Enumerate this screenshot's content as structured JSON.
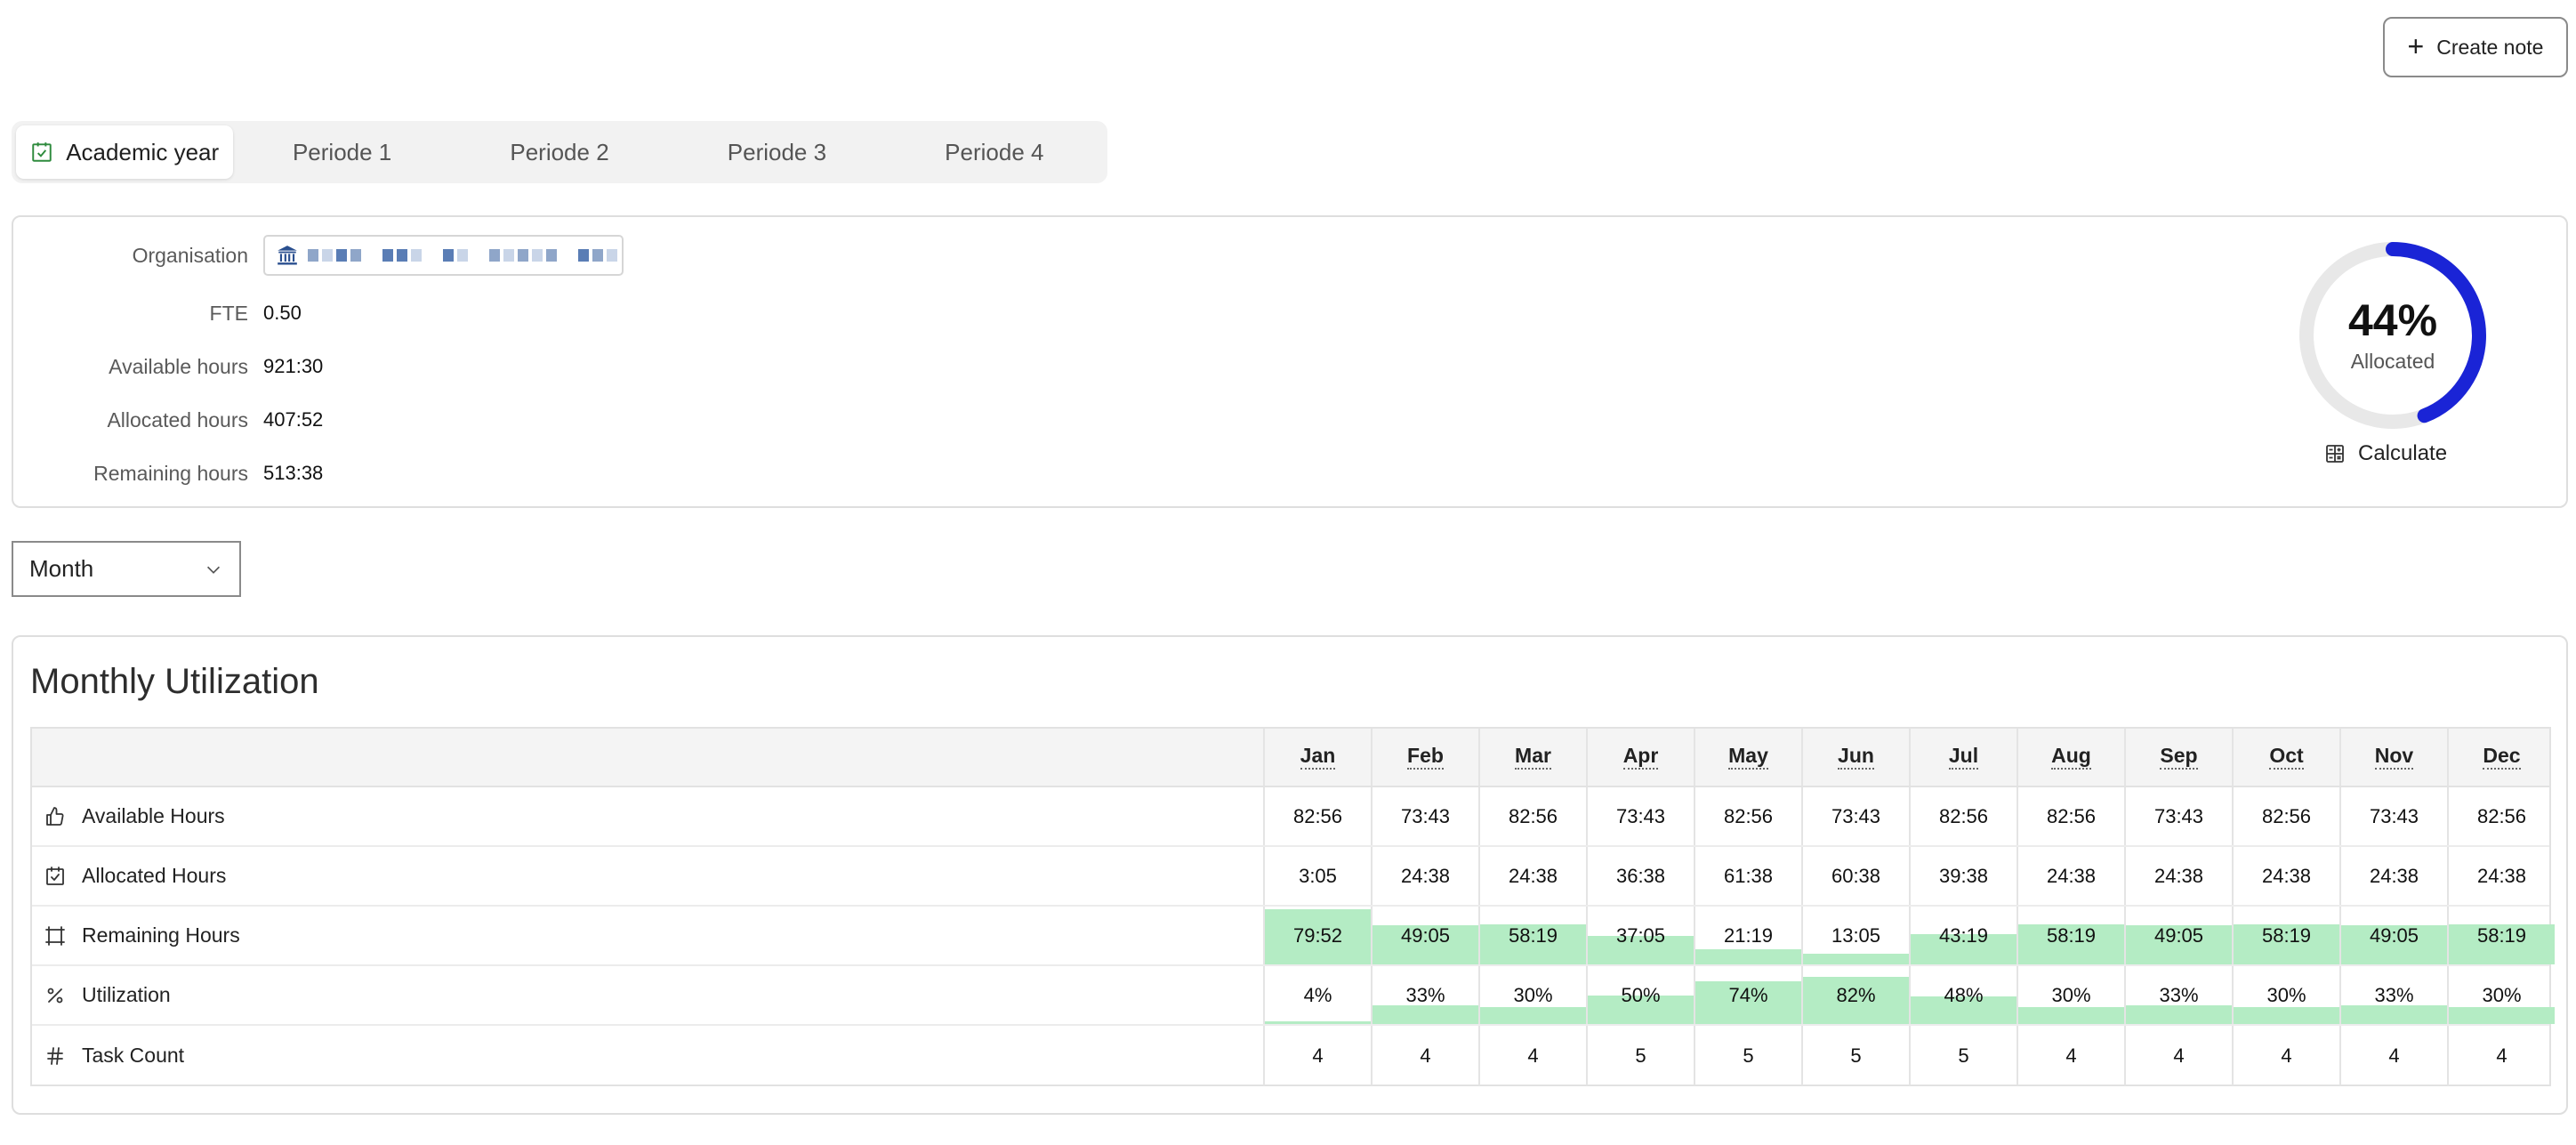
{
  "header": {
    "create_note_label": "Create note"
  },
  "tabs": [
    {
      "label": "Academic year",
      "active": true
    },
    {
      "label": "Periode 1",
      "active": false
    },
    {
      "label": "Periode 2",
      "active": false
    },
    {
      "label": "Periode 3",
      "active": false
    },
    {
      "label": "Periode 4",
      "active": false
    }
  ],
  "info": {
    "organisation_label": "Organisation",
    "fte_label": "FTE",
    "fte_value": "0.50",
    "available_label": "Available hours",
    "available_value": "921:30",
    "allocated_label": "Allocated hours",
    "allocated_value": "407:52",
    "remaining_label": "Remaining hours",
    "remaining_value": "513:38"
  },
  "allocation": {
    "percent": 44,
    "percent_label": "44%",
    "sub_label": "Allocated",
    "calculate_label": "Calculate",
    "ring_color": "#1a24d6",
    "track_color": "#e8e8e8"
  },
  "period_select": {
    "value": "Month"
  },
  "utilization": {
    "title": "Monthly Utilization",
    "months": [
      "Jan",
      "Feb",
      "Mar",
      "Apr",
      "May",
      "Jun",
      "Jul",
      "Aug",
      "Sep",
      "Oct",
      "Nov",
      "Dec"
    ],
    "rows": [
      {
        "label": "Available Hours",
        "icon": "thumbs-up-icon",
        "values": [
          "82:56",
          "73:43",
          "82:56",
          "73:43",
          "82:56",
          "73:43",
          "82:56",
          "82:56",
          "73:43",
          "82:56",
          "73:43",
          "82:56"
        ]
      },
      {
        "label": "Allocated Hours",
        "icon": "calendar-check-icon",
        "values": [
          "3:05",
          "24:38",
          "24:38",
          "36:38",
          "61:38",
          "60:38",
          "39:38",
          "24:38",
          "24:38",
          "24:38",
          "24:38",
          "24:38"
        ]
      },
      {
        "label": "Remaining Hours",
        "icon": "frame-icon",
        "values": [
          "79:52",
          "49:05",
          "58:19",
          "37:05",
          "21:19",
          "13:05",
          "43:19",
          "58:19",
          "49:05",
          "58:19",
          "49:05",
          "58:19"
        ],
        "fill_fractions": [
          0.96,
          0.67,
          0.7,
          0.5,
          0.26,
          0.18,
          0.52,
          0.7,
          0.67,
          0.7,
          0.67,
          0.7
        ]
      },
      {
        "label": "Utilization",
        "icon": "percent-icon",
        "values": [
          "4%",
          "33%",
          "30%",
          "50%",
          "74%",
          "82%",
          "48%",
          "30%",
          "33%",
          "30%",
          "33%",
          "30%"
        ],
        "fill_fractions": [
          0.04,
          0.33,
          0.3,
          0.5,
          0.74,
          0.82,
          0.48,
          0.3,
          0.33,
          0.3,
          0.33,
          0.3
        ]
      },
      {
        "label": "Task Count",
        "icon": "hash-icon",
        "values": [
          "4",
          "4",
          "4",
          "5",
          "5",
          "5",
          "5",
          "4",
          "4",
          "4",
          "4",
          "4"
        ]
      }
    ],
    "fill_color": "#b4ecc4"
  }
}
